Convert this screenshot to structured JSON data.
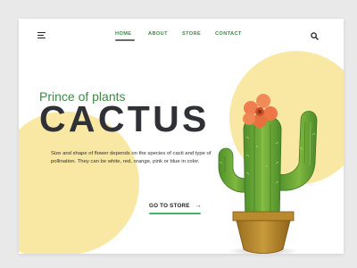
{
  "nav": {
    "items": [
      {
        "label": "HOME",
        "active": true
      },
      {
        "label": "ABOUT",
        "active": false
      },
      {
        "label": "STORE",
        "active": false
      },
      {
        "label": "CONTACT",
        "active": false
      }
    ]
  },
  "icons": {
    "menu": "hamburger-menu-icon",
    "search": "search-icon",
    "cta_arrow": "arrow-right-icon"
  },
  "hero": {
    "subtitle": "Prince of plants",
    "title": "CACTUS",
    "description": "Size and shape of flower depends on the species of cacti and type of pollination. They can be white, red, orange, pink or blue in color.",
    "cta_label": "GO TO STORE",
    "cta_arrow": "→"
  },
  "colors": {
    "accent_green": "#3d8a45",
    "blob_yellow": "#f9e8a3",
    "headline_dark": "#2f3136",
    "cta_underline": "#3fb76a",
    "pot_brown": "#b98a2e",
    "flower_orange": "#ef7d4f"
  }
}
